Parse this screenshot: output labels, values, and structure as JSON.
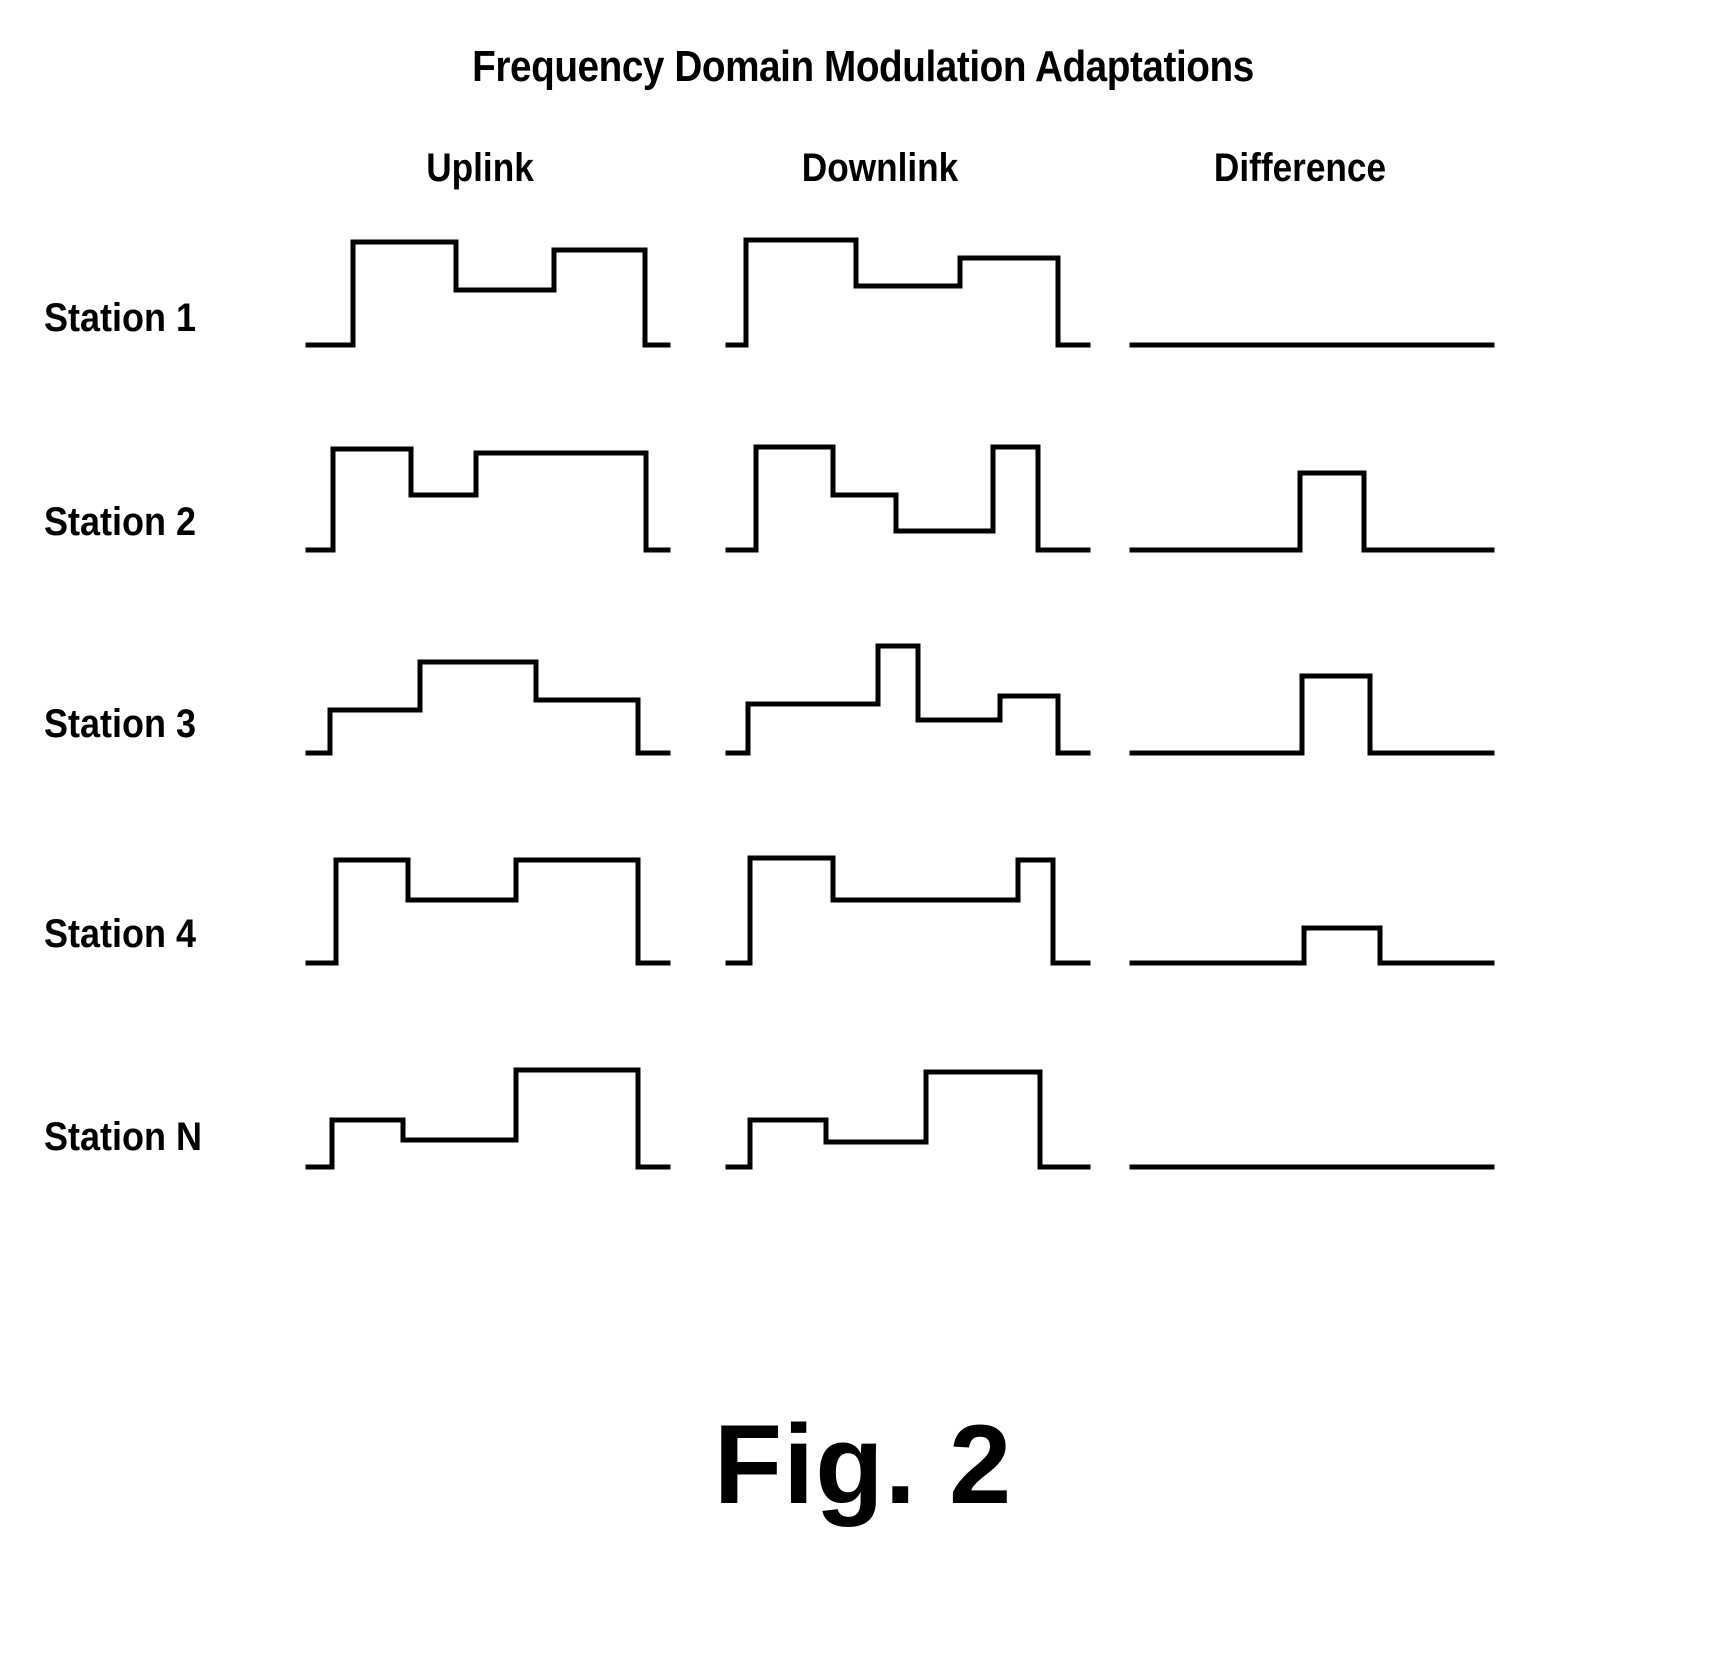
{
  "figure": {
    "title": "Frequency Domain Modulation Adaptations",
    "caption": "Fig. 2"
  },
  "columns": [
    {
      "key": "uplink",
      "label": "Uplink"
    },
    {
      "key": "downlink",
      "label": "Downlink"
    },
    {
      "key": "difference",
      "label": "Difference"
    }
  ],
  "rows": [
    {
      "key": "station1",
      "label": "Station 1"
    },
    {
      "key": "station2",
      "label": "Station 2"
    },
    {
      "key": "station3",
      "label": "Station 3"
    },
    {
      "key": "station4",
      "label": "Station 4"
    },
    {
      "key": "stationN",
      "label": "Station N"
    }
  ],
  "chart_data": {
    "type": "area",
    "title": "Frequency Domain Modulation Adaptations",
    "xlabel": "",
    "ylabel": "",
    "grid": false,
    "legend": "none",
    "description": "Grid of step-function spectral profiles. Each cell shows modulation level versus frequency sub-band as a staircase outline above a horizontal baseline. Rows are stations, columns are Uplink, Downlink and the Difference between them.",
    "x_band_count": 8,
    "y_levels": [
      0,
      1,
      2,
      3,
      4
    ],
    "panels": [
      {
        "row": "Station 1",
        "column": "Uplink",
        "levels": [
          3,
          3,
          3,
          2,
          2,
          3.2,
          3.2,
          3.2
        ],
        "baseline": 0
      },
      {
        "row": "Station 1",
        "column": "Downlink",
        "levels": [
          3.2,
          3.2,
          3.2,
          2.2,
          2.2,
          2.2,
          2.9,
          2.9
        ],
        "baseline": 0
      },
      {
        "row": "Station 1",
        "column": "Difference",
        "levels": [
          0,
          0,
          0,
          0,
          0,
          0,
          0,
          0
        ],
        "baseline": 0
      },
      {
        "row": "Station 2",
        "column": "Uplink",
        "levels": [
          3.1,
          3.1,
          2.2,
          2.2,
          3.0,
          3.0,
          3.0,
          3.0
        ],
        "baseline": 0
      },
      {
        "row": "Station 2",
        "column": "Downlink",
        "levels": [
          3.2,
          3.2,
          2.4,
          2.4,
          1.5,
          1.5,
          3.1,
          3.1
        ],
        "baseline": 0
      },
      {
        "row": "Station 2",
        "column": "Difference",
        "levels": [
          0,
          0,
          0,
          0,
          1.7,
          1.7,
          0,
          0
        ],
        "baseline": 0
      },
      {
        "row": "Station 3",
        "column": "Uplink",
        "levels": [
          1.8,
          1.8,
          3.0,
          3.0,
          3.0,
          2.0,
          2.0,
          2.0
        ],
        "baseline": 0
      },
      {
        "row": "Station 3",
        "column": "Downlink",
        "levels": [
          2.1,
          2.1,
          2.1,
          3.6,
          1.3,
          1.3,
          2.2,
          2.2
        ],
        "baseline": 0
      },
      {
        "row": "Station 3",
        "column": "Difference",
        "levels": [
          0,
          0,
          0,
          0,
          2.0,
          2.0,
          0,
          0
        ],
        "baseline": 0
      },
      {
        "row": "Station 4",
        "column": "Uplink",
        "levels": [
          3.1,
          3.1,
          2.2,
          2.2,
          3.1,
          3.1,
          3.1,
          3.1
        ],
        "baseline": 0
      },
      {
        "row": "Station 4",
        "column": "Downlink",
        "levels": [
          3.2,
          3.2,
          2.2,
          2.2,
          2.2,
          2.2,
          3.2,
          3.2
        ],
        "baseline": 0
      },
      {
        "row": "Station 4",
        "column": "Difference",
        "levels": [
          0,
          0,
          0,
          0,
          0.8,
          0.8,
          0,
          0
        ],
        "baseline": 0
      },
      {
        "row": "Station N",
        "column": "Uplink",
        "levels": [
          2.0,
          2.0,
          1.4,
          1.4,
          1.4,
          3.2,
          3.2,
          3.2
        ],
        "baseline": 0
      },
      {
        "row": "Station N",
        "column": "Downlink",
        "levels": [
          2.1,
          2.1,
          1.5,
          1.5,
          1.5,
          3.3,
          3.3,
          3.3
        ],
        "baseline": 0
      },
      {
        "row": "Station N",
        "column": "Difference",
        "levels": [
          0,
          0,
          0,
          0,
          0,
          0,
          0,
          0
        ],
        "baseline": 0
      }
    ]
  },
  "geometry": {
    "comment": "SVG polyline point strings in local cell coordinates (width 360 x height 130, baseline y=125).",
    "paths": {
      "s1_up": "0,125 45,125 45,22 148,22 148,70 246,70 246,30 337,30 337,125 360,125",
      "s1_down": "0,125 18,125 18,20 128,20 128,66 232,66 232,38 330,38 330,125 360,125",
      "s1_diff": "0,125 360,125",
      "s2_up": "0,125 25,125 25,24 103,24 103,70 168,70 168,28 338,28 338,125 360,125",
      "s2_down": "0,125 28,125 28,22 105,22 105,70 168,70 168,106 265,106 265,22 310,22 310,125 360,125",
      "s2_diff": "0,125 168,125 168,48 232,48 232,125 360,125",
      "s3_up": "0,125 22,125 22,82 112,82 112,34 228,34 228,72 330,72 330,125 360,125",
      "s3_down": "0,125 20,125 20,76 150,76 150,18 190,18 190,92 272,92 272,68 330,68 330,125 360,125",
      "s3_diff": "0,125 170,125 170,48 238,48 238,125 360,125",
      "s4_up": "0,125 28,125 28,22 100,22 100,62 208,62 208,22 330,22 330,125 360,125",
      "s4_down": "0,125 22,125 22,20 105,20 105,62 290,62 290,22 325,22 325,125 360,125",
      "s4_diff": "0,125 172,125 172,90 248,90 248,125 360,125",
      "sN_up": "0,125 24,125 24,78 95,78 95,98 208,98 208,28 330,28 330,125 360,125",
      "sN_down": "0,125 22,125 22,78 98,78 98,100 198,100 198,30 312,30 312,125 360,125",
      "sN_diff": "0,125 360,125"
    }
  }
}
